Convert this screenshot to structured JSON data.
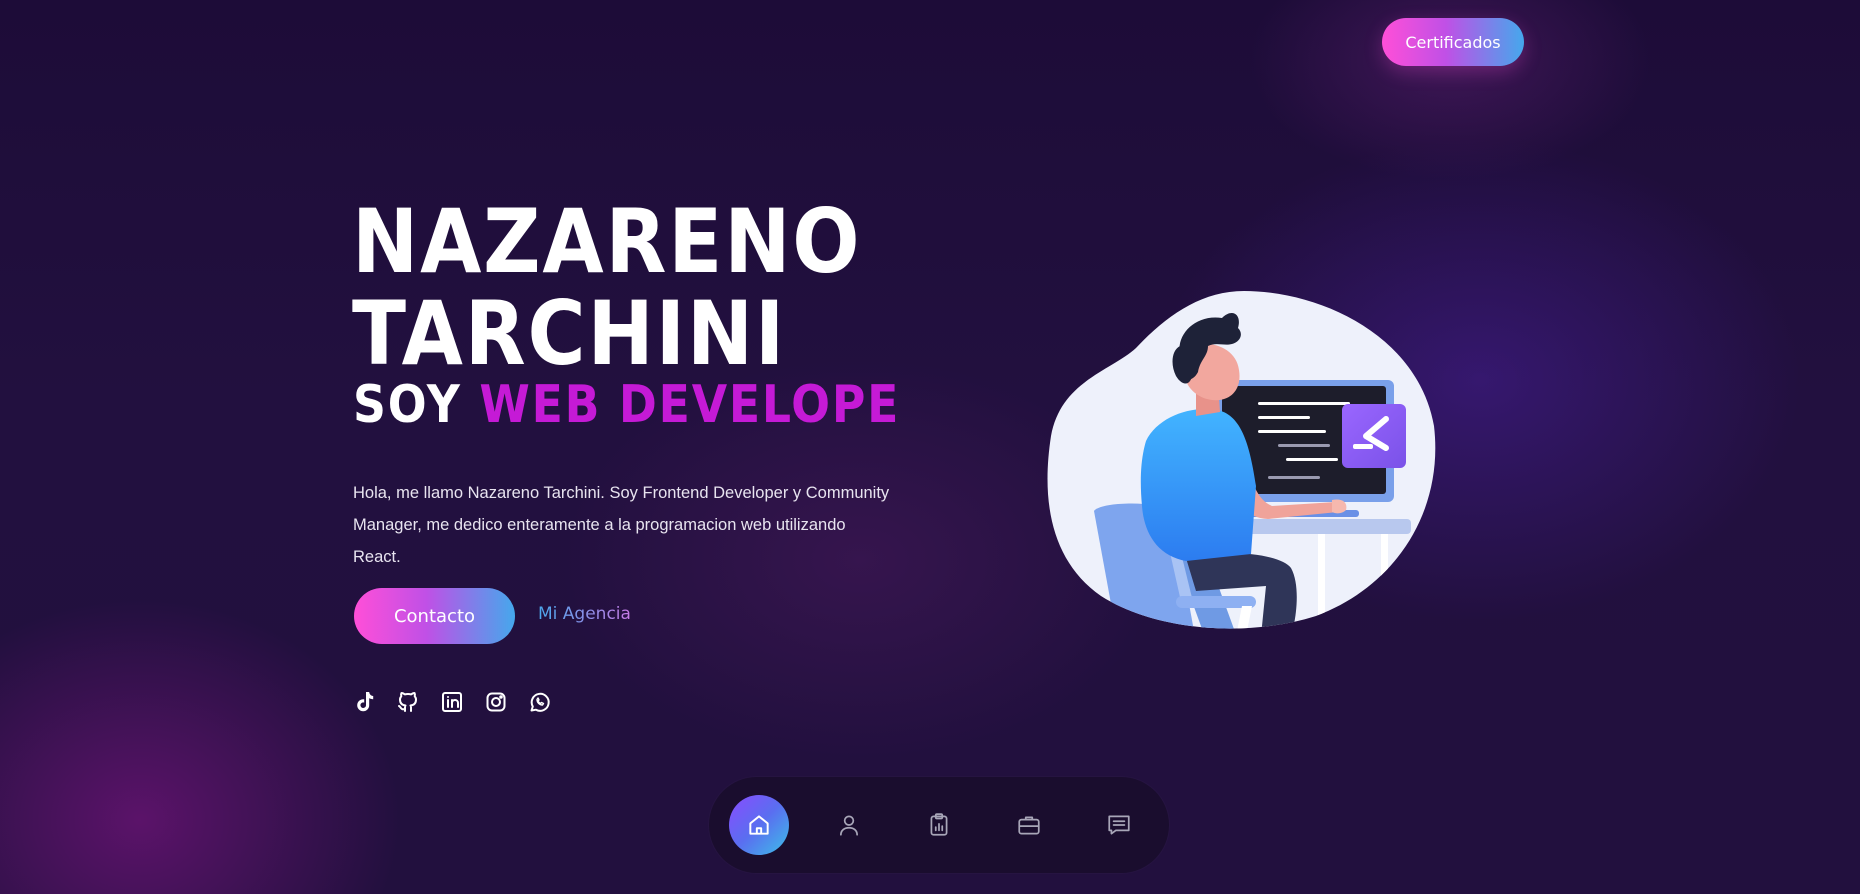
{
  "header": {
    "certificates_label": "Certificados"
  },
  "hero": {
    "name_line1": "NAZARENO",
    "name_line2": "TARCHINI",
    "role_prefix": "SOY",
    "role_accent": "WEB DEVELOPE",
    "description": "Hola, me llamo Nazareno Tarchini. Soy Frontend Developer y Community Manager, me dedico enteramente a la programacion web utilizando React.",
    "contact_label": "Contacto",
    "agency_label": "Mi Agencia"
  },
  "socials": [
    {
      "icon": "tiktok-icon"
    },
    {
      "icon": "github-icon"
    },
    {
      "icon": "linkedin-icon"
    },
    {
      "icon": "instagram-icon"
    },
    {
      "icon": "whatsapp-icon"
    }
  ],
  "nav": {
    "items": [
      {
        "icon": "home-icon",
        "active": true
      },
      {
        "icon": "user-icon",
        "active": false
      },
      {
        "icon": "clipboard-icon",
        "active": false
      },
      {
        "icon": "briefcase-icon",
        "active": false
      },
      {
        "icon": "message-icon",
        "active": false
      }
    ]
  },
  "colors": {
    "background": "#1e0d3c",
    "accent_magenta": "#c51ad6",
    "gradient_start": "#ff4fd8",
    "gradient_end": "#45a8ec",
    "nav_bg": "#1a0d2e"
  }
}
